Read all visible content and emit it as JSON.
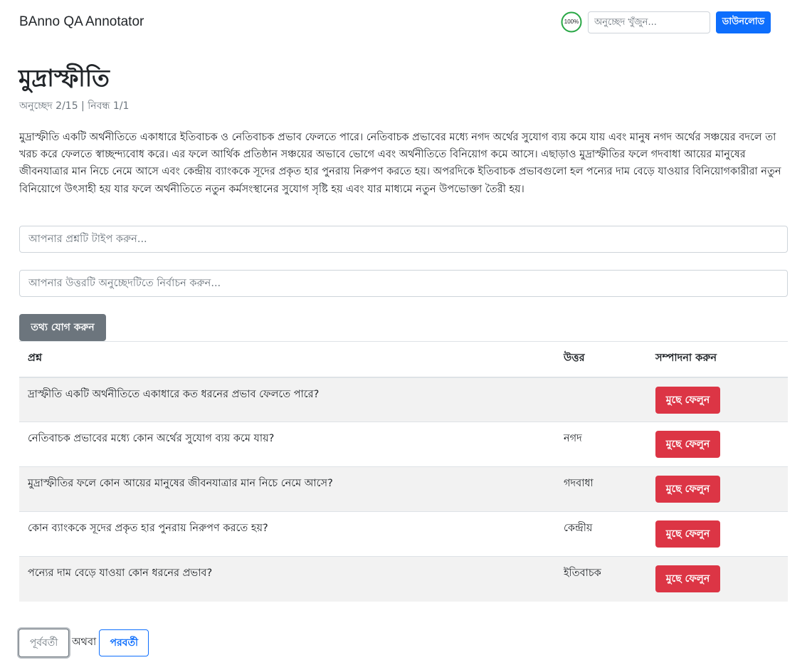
{
  "app": {
    "title": "BAnno QA Annotator"
  },
  "header": {
    "progress_label": "100%",
    "progress_value": 1.0,
    "search_placeholder": "অনুচ্ছেদ খুঁজুন...",
    "download_label": "ডাউনলোড"
  },
  "article": {
    "title": "মুদ্রাস্ফীতি",
    "meta": "অনুচ্ছেদ 2/15 | নিবন্ধ 1/1",
    "passage": "মুদ্রাস্ফীতি একটি অর্থনীতিতে একাধারে ইতিবাচক ও নেতিবাচক প্রভাব ফেলতে পারে। নেতিবাচক প্রভাবের মধ্যে নগদ অর্থের সুযোগ ব্যয় কমে যায় এবং মানুষ নগদ অর্থের সঞ্চয়ের বদলে তা খরচ করে ফেলতে স্বাচ্ছন্দ্যবোধ করে। এর ফলে আর্থিক প্রতিষ্ঠান সঞ্চয়ের অভাবে ভোগে এবং অর্থনীতিতে বিনিয়োগ কমে আসে। এছাড়াও মুদ্রাস্ফীতির ফলে গদবাধা আয়ের মানুষের জীবনযাত্রার মান নিচে নেমে আসে এবং কেন্দ্রীয় ব্যাংককে সূদের প্রকৃত হার পুনরায় নিরুপণ করতে হয়। অপরদিকে ইতিবাচক প্রভাবগুলো হল পন্যের দাম বেড়ে যাওয়ার বিনিয়োগকারীরা নতুন বিনিয়োগে উৎসাহী হয় যার ফলে অর্থনীতিতে নতুন কর্মসংস্থানের সুযোগ সৃষ্টি হয় এবং যার মাধ্যমে নতুন উপভোক্তা তৈরী হয়।"
  },
  "form": {
    "question_placeholder": "আপনার প্রশ্নটি টাইপ করুন...",
    "answer_placeholder": "আপনার উত্তরটি অনুচ্ছেদটিতে নির্বাচন করুন...",
    "add_label": "তথ্য যোগ করুন"
  },
  "table": {
    "headers": {
      "question": "প্রশ্ন",
      "answer": "উত্তর",
      "edit": "সম্পাদনা করুন"
    },
    "delete_label": "মুছে ফেলুন",
    "rows": [
      {
        "question": "দ্রাস্ফীতি একটি অর্থনীতিতে একাধারে কত ধরনের প্রভাব ফেলতে পারে?",
        "answer": ""
      },
      {
        "question": "নেতিবাচক প্রভাবের মধ্যে কোন অর্থের সুযোগ ব্যয় কমে যায়?",
        "answer": "নগদ"
      },
      {
        "question": "মুদ্রাস্ফীতির ফলে কোন আয়ের মানুষের জীবনযাত্রার মান নিচে নেমে আসে?",
        "answer": "গদবাধা"
      },
      {
        "question": "কোন ব্যাংককে সূদের প্রকৃত হার পুনরায় নিরুপণ করতে হয়?",
        "answer": "কেন্দ্রীয়"
      },
      {
        "question": "পন্যের দাম বেড়ে যাওয়া কোন ধরনের প্রভাব?",
        "answer": "ইতিবাচক"
      }
    ]
  },
  "pager": {
    "prev_label": "পূর্ববর্তী",
    "or_label": "অথবা",
    "next_label": "পরবর্তী"
  },
  "colors": {
    "primary": "#0d6efd",
    "danger": "#dc3545",
    "secondary": "#6c757d",
    "progress": "#28a745"
  }
}
